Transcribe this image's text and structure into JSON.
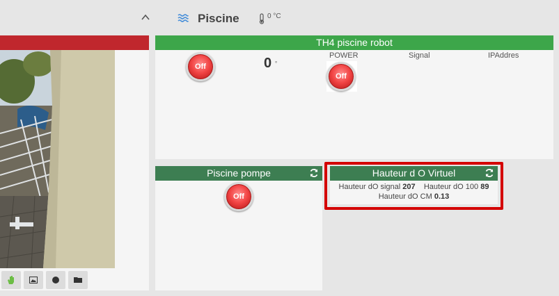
{
  "header": {
    "title": "Piscine",
    "temperature": "0 °C"
  },
  "robot": {
    "title": "TH4 piscine robot",
    "value": "0",
    "value_unit": "°",
    "power_label": "POWER",
    "signal_label": "Signal",
    "ip_label": "IPAddres",
    "switch1_label": "Off",
    "switch2_label": "Off"
  },
  "pompe": {
    "title": "Piscine pompe",
    "switch_label": "Off"
  },
  "virtuel": {
    "title": "Hauteur d O Virtuel",
    "signal_label": "Hauteur dO signal",
    "signal_value": "207",
    "pct_label": "Hauteur dO 100",
    "pct_value": "89",
    "cm_label": "Hauteur dO CM",
    "cm_value": "0.13"
  },
  "colors": {
    "green": "#3da64a",
    "dark_green": "#3d7e52",
    "red_bar": "#c0272d",
    "highlight": "#d40000"
  }
}
